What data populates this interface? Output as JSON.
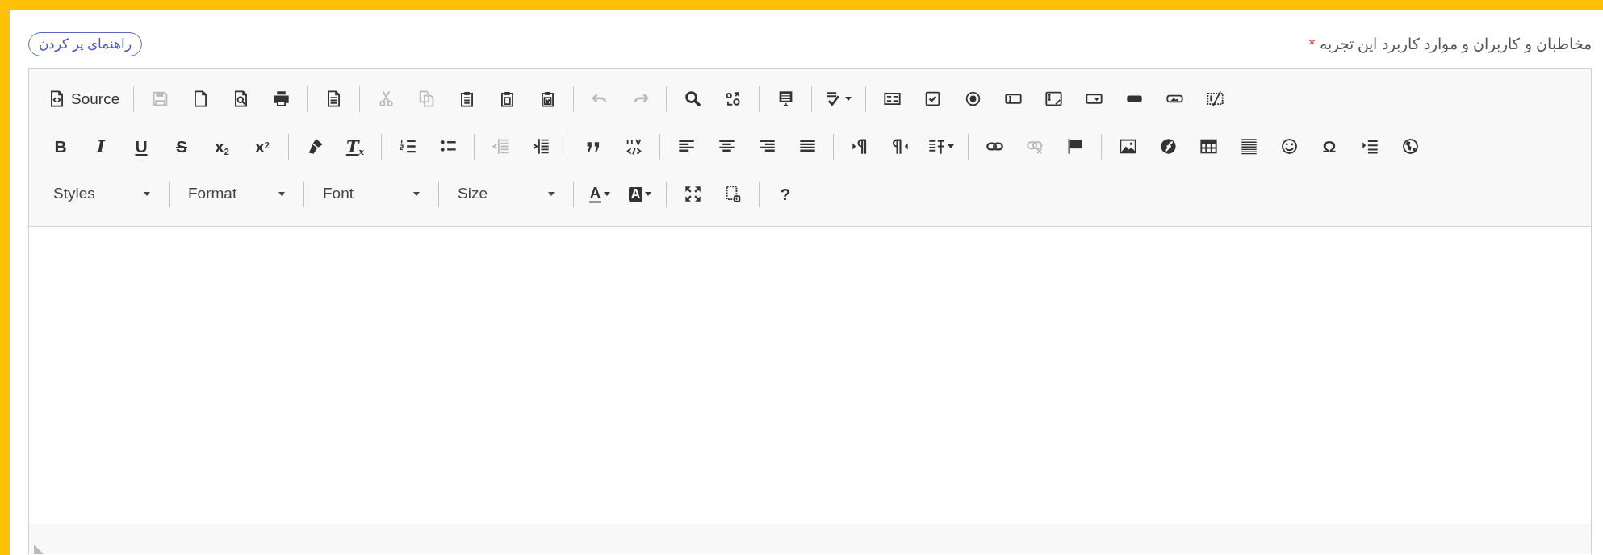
{
  "field": {
    "label": "مخاطبان و کاربران و موارد کاربرد این تجربه",
    "required_mark": "*",
    "help_button": "راهنمای پر کردن"
  },
  "editor": {
    "toolbar": [
      {
        "groups": [
          {
            "items": [
              {
                "kind": "text",
                "label": "Source",
                "disabled": false
              }
            ]
          },
          {
            "items": [
              {
                "kind": "icon",
                "disabled": true
              },
              {
                "kind": "icon",
                "disabled": false
              },
              {
                "kind": "icon",
                "disabled": false
              },
              {
                "kind": "icon",
                "disabled": false
              }
            ]
          },
          {
            "items": [
              {
                "kind": "icon",
                "disabled": false
              }
            ]
          },
          {
            "items": [
              {
                "kind": "icon",
                "disabled": true
              },
              {
                "kind": "icon",
                "disabled": true
              },
              {
                "kind": "icon",
                "disabled": false
              },
              {
                "kind": "icon",
                "disabled": false
              },
              {
                "kind": "icon",
                "disabled": false
              }
            ]
          },
          {
            "items": [
              {
                "kind": "icon",
                "disabled": true
              },
              {
                "kind": "icon",
                "disabled": true
              }
            ]
          },
          {
            "items": [
              {
                "kind": "icon",
                "disabled": false
              },
              {
                "kind": "icon",
                "disabled": false
              }
            ]
          },
          {
            "items": [
              {
                "kind": "icon",
                "disabled": false
              }
            ]
          },
          {
            "items": [
              {
                "kind": "icon",
                "disabled": false
              }
            ]
          },
          {
            "items": [
              {
                "kind": "icon",
                "disabled": false
              },
              {
                "kind": "icon",
                "disabled": false
              },
              {
                "kind": "icon",
                "disabled": false
              },
              {
                "kind": "icon",
                "disabled": false
              },
              {
                "kind": "icon",
                "disabled": false
              },
              {
                "kind": "icon",
                "disabled": false
              },
              {
                "kind": "icon",
                "disabled": false
              },
              {
                "kind": "icon",
                "disabled": false
              },
              {
                "kind": "icon",
                "disabled": false
              }
            ]
          }
        ]
      },
      {
        "groups": [
          {
            "items": [
              {
                "kind": "glyph",
                "glyph": "B",
                "disabled": false
              },
              {
                "kind": "glyph",
                "glyph": "I",
                "disabled": false
              },
              {
                "kind": "glyph",
                "glyph": "U",
                "disabled": false
              },
              {
                "kind": "glyph",
                "glyph": "S",
                "disabled": false
              },
              {
                "kind": "glyph",
                "glyph": "x$_{2}$",
                "disabled": false
              },
              {
                "kind": "glyph",
                "glyph": "x$^{2}$",
                "disabled": false
              }
            ]
          },
          {
            "items": [
              {
                "kind": "icon",
                "disabled": false
              },
              {
                "kind": "glyph",
                "glyph": "T$_{x}$",
                "disabled": false
              }
            ]
          },
          {
            "items": [
              {
                "kind": "icon",
                "disabled": false
              },
              {
                "kind": "icon",
                "disabled": false
              }
            ]
          },
          {
            "items": [
              {
                "kind": "icon",
                "disabled": true
              },
              {
                "kind": "icon",
                "disabled": false
              }
            ]
          },
          {
            "items": [
              {
                "kind": "icon",
                "disabled": false
              },
              {
                "kind": "icon",
                "disabled": false
              }
            ]
          },
          {
            "items": [
              {
                "kind": "icon",
                "disabled": false
              },
              {
                "kind": "icon",
                "disabled": false
              },
              {
                "kind": "icon",
                "disabled": false
              },
              {
                "kind": "icon",
                "disabled": false
              }
            ]
          },
          {
            "items": [
              {
                "kind": "icon",
                "disabled": false
              },
              {
                "kind": "icon",
                "disabled": false
              },
              {
                "kind": "icon",
                "disabled": false
              }
            ]
          },
          {
            "items": [
              {
                "kind": "icon",
                "disabled": false
              },
              {
                "kind": "icon",
                "disabled": true
              },
              {
                "kind": "icon",
                "disabled": false
              }
            ]
          },
          {
            "items": [
              {
                "kind": "icon",
                "disabled": false
              },
              {
                "kind": "icon",
                "disabled": false
              },
              {
                "kind": "icon",
                "disabled": false
              },
              {
                "kind": "icon",
                "disabled": false
              },
              {
                "kind": "icon",
                "disabled": false
              },
              {
                "kind": "glyph",
                "glyph": "Ω",
                "disabled": false
              },
              {
                "kind": "icon",
                "disabled": false
              },
              {
                "kind": "icon",
                "disabled": false
              }
            ]
          }
        ]
      },
      {
        "groups": [
          {
            "items": [
              {
                "kind": "combo",
                "label": "Styles"
              }
            ]
          },
          {
            "items": [
              {
                "kind": "combo",
                "label": "Format"
              }
            ]
          },
          {
            "items": [
              {
                "kind": "combo",
                "label": "Font"
              }
            ]
          },
          {
            "items": [
              {
                "kind": "combo",
                "label": "Size"
              }
            ]
          },
          {
            "items": [
              {
                "kind": "glyph",
                "glyph": "A",
                "disabled": false
              },
              {
                "kind": "glyph",
                "glyph": "A",
                "disabled": false
              }
            ]
          },
          {
            "items": [
              {
                "kind": "icon",
                "disabled": false
              },
              {
                "kind": "icon",
                "disabled": false
              }
            ]
          },
          {
            "items": [
              {
                "kind": "glyph",
                "glyph": "?",
                "disabled": false
              }
            ]
          }
        ]
      }
    ]
  }
}
